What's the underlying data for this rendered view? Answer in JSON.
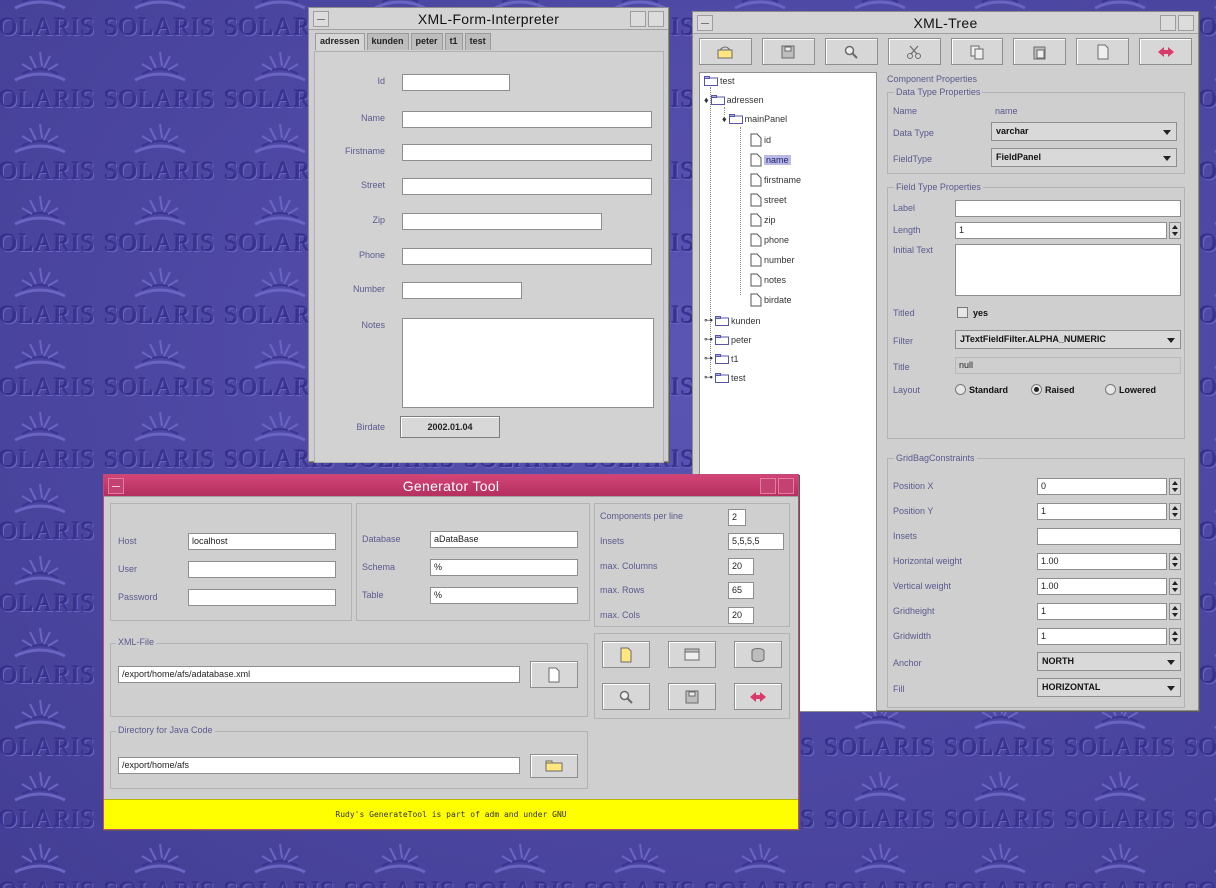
{
  "desktop": {
    "wallpaper_text": "SOLARIS",
    "colors": {
      "background": "#4f4aa6",
      "text": "#3a3590"
    }
  },
  "form_window": {
    "title": "XML-Form-Interpreter",
    "tabs": [
      "adressen",
      "kunden",
      "peter",
      "t1",
      "test"
    ],
    "active_tab": "adressen",
    "labels": {
      "id": "Id",
      "name": "Name",
      "firstname": "Firstname",
      "street": "Street",
      "zip": "Zip",
      "phone": "Phone",
      "number": "Number",
      "notes": "Notes",
      "birthdate": "Birdate"
    },
    "birthdate_value": "2002.01.04"
  },
  "tree_window": {
    "title": "XML-Tree",
    "toolbar": [
      "open-icon",
      "save-icon",
      "search-icon",
      "cut-icon",
      "copy-icon",
      "paste-icon",
      "new-icon",
      "exit-icon"
    ],
    "tree": {
      "root": "test",
      "adressen": "adressen",
      "mainPanel": "mainPanel",
      "fields": [
        "id",
        "name",
        "firstname",
        "street",
        "zip",
        "phone",
        "number",
        "notes",
        "birdate"
      ],
      "selected": "name",
      "siblings": [
        "kunden",
        "peter",
        "t1",
        "test"
      ]
    },
    "properties": {
      "heading": "Component Properties",
      "data_type_group": "Data Type Properties",
      "name_label": "Name",
      "name_value": "name",
      "datatype_label": "Data Type",
      "datatype_value": "varchar",
      "fieldtype_label": "FieldType",
      "fieldtype_value": "FieldPanel",
      "field_type_group": "Field Type Properties",
      "label_label": "Label",
      "label_value": "",
      "length_label": "Length",
      "length_value": "1",
      "initial_text_label": "Initial Text",
      "titled_label": "Titled",
      "titled_check": "yes",
      "filter_label": "Filter",
      "filter_value": "JTextFieldFilter.ALPHA_NUMERIC",
      "title_label": "Title",
      "title_value": "null",
      "layout_label": "Layout",
      "layout_options": [
        "Standard",
        "Raised",
        "Lowered"
      ],
      "layout_selected": "Raised",
      "gridbag_group": "GridBagConstraints",
      "positionx_label": "Position X",
      "positionx_value": "0",
      "positiony_label": "Position Y",
      "positiony_value": "1",
      "insets_label": "Insets",
      "insets_value": "",
      "hweight_label": "Horizontal weight",
      "hweight_value": "1.00",
      "vweight_label": "Vertical weight",
      "vweight_value": "1.00",
      "gridheight_label": "Gridheight",
      "gridheight_value": "1",
      "gridwidth_label": "Gridwidth",
      "gridwidth_value": "1",
      "anchor_label": "Anchor",
      "anchor_value": "NORTH",
      "fill_label": "Fill",
      "fill_value": "HORIZONTAL"
    }
  },
  "generator_window": {
    "title": "Generator Tool",
    "colors": {
      "title_bar": "#c23a6a",
      "status_bar": "#ffff00"
    },
    "db": {
      "host_label": "Host",
      "host_value": "localhost",
      "user_label": "User",
      "user_value": "",
      "password_label": "Password",
      "password_value": "",
      "database_label": "Database",
      "database_value": "aDataBase",
      "schema_label": "Schema",
      "schema_value": "%",
      "table_label": "Table",
      "table_value": "%"
    },
    "layout": {
      "components_label": "Components per line",
      "components_value": "2",
      "insets_label": "Insets",
      "insets_value": "5,5,5,5",
      "maxcolumns_label": "max. Columns",
      "maxcolumns_value": "20",
      "maxrows_label": "max. Rows",
      "maxrows_value": "65",
      "maxcols_label": "max. Cols",
      "maxcols_value": "20"
    },
    "xml_file": {
      "group": "XML-File",
      "path": "/export/home/afs/adatabase.xml"
    },
    "java_dir": {
      "group": "Directory for Java Code",
      "path": "/export/home/afs"
    },
    "buttons": [
      "new-icon",
      "window-icon",
      "database-icon",
      "search-icon",
      "save-icon",
      "exit-icon"
    ],
    "status": "Rudy's GenerateTool is part of adm and under GNU"
  }
}
